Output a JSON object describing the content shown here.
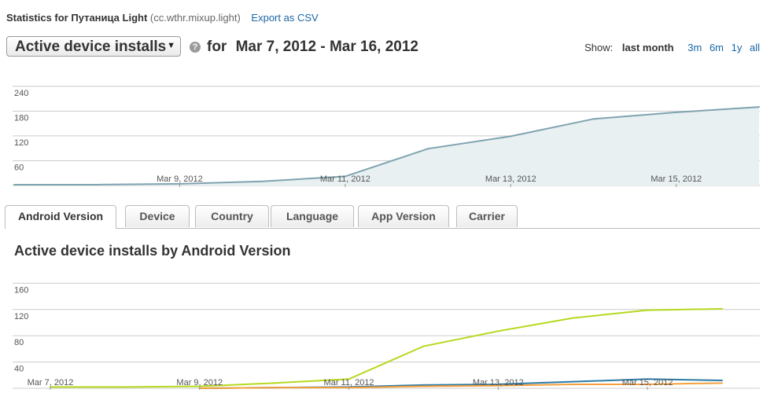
{
  "header": {
    "stats_label": "Statistics for Путаница Light",
    "package": "(cc.wthr.mixup.light)",
    "export_link": "Export as CSV"
  },
  "metric_select": {
    "value": "Active device installs"
  },
  "help_icon": "?",
  "date_range": {
    "for_label": "for",
    "range": "Mar 7, 2012 - Mar 16, 2012"
  },
  "show": {
    "label": "Show:",
    "current": "last month",
    "options": [
      "3m",
      "6m",
      "1y",
      "all"
    ]
  },
  "tabs": [
    {
      "label": "Android Version",
      "active": true
    },
    {
      "label": "Device",
      "active": false
    },
    {
      "label": "Country",
      "active": false
    },
    {
      "label": "Language",
      "active": false
    },
    {
      "label": "App Version",
      "active": false
    },
    {
      "label": "Carrier",
      "active": false
    }
  ],
  "breakdown_title": "Active device installs by Android Version",
  "colors": {
    "total_line": "#7fa3b0",
    "total_fill": "#e8f0f2",
    "series_green": "#b5d91e",
    "series_blue": "#2b7aa6",
    "series_orange": "#f5a03c",
    "grid": "#cccccc",
    "link": "#1a66a5"
  },
  "chart_data": [
    {
      "type": "area",
      "x": [
        "Mar 7, 2012",
        "Mar 8, 2012",
        "Mar 9, 2012",
        "Mar 10, 2012",
        "Mar 11, 2012",
        "Mar 12, 2012",
        "Mar 13, 2012",
        "Mar 14, 2012",
        "Mar 15, 2012",
        "Mar 16, 2012"
      ],
      "series": [
        {
          "values": [
            2,
            2,
            4,
            10,
            22,
            89,
            119,
            161,
            177,
            190
          ]
        }
      ],
      "x_ticks": [
        "Mar 9, 2012",
        "Mar 11, 2012",
        "Mar 13, 2012",
        "Mar 15, 2012"
      ],
      "y_ticks": [
        "60",
        "120",
        "180",
        "240"
      ],
      "ylim": [
        0,
        270
      ],
      "grid": true
    },
    {
      "type": "line",
      "x": [
        "Mar 7, 2012",
        "Mar 8, 2012",
        "Mar 9, 2012",
        "Mar 10, 2012",
        "Mar 11, 2012",
        "Mar 12, 2012",
        "Mar 13, 2012",
        "Mar 14, 2012",
        "Mar 15, 2012",
        "Mar 16, 2012"
      ],
      "series": [
        {
          "color": "#b5d91e",
          "values": [
            2,
            2,
            3,
            8,
            14,
            64,
            87,
            107,
            119,
            121
          ]
        },
        {
          "color": "#2b7aa6",
          "values": [
            null,
            null,
            0,
            1,
            2,
            5,
            6,
            10,
            14,
            12
          ]
        },
        {
          "color": "#f5a03c",
          "values": [
            null,
            null,
            0,
            1,
            1,
            3,
            4,
            6,
            6,
            8
          ]
        }
      ],
      "x_ticks": [
        "Mar 7, 2012",
        "Mar 9, 2012",
        "Mar 11, 2012",
        "Mar 13, 2012",
        "Mar 15, 2012"
      ],
      "y_ticks": [
        "40",
        "80",
        "120",
        "160"
      ],
      "ylim": [
        0,
        170
      ],
      "grid": true
    }
  ]
}
